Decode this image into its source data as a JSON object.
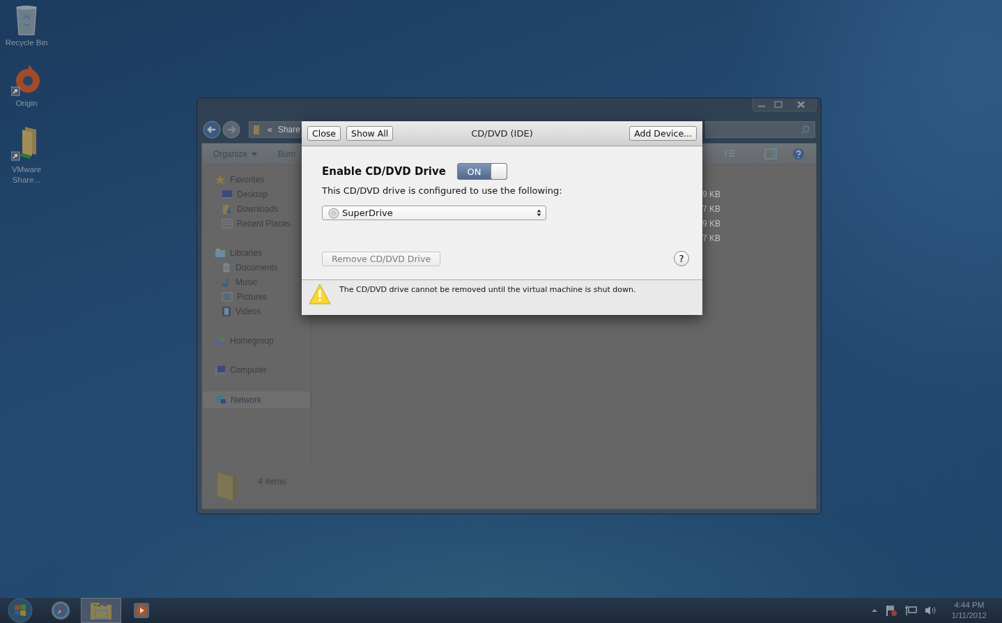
{
  "desktop_icons": [
    {
      "kind": "recycle-bin",
      "label": "Recycle Bin",
      "shortcut": false
    },
    {
      "kind": "origin",
      "label": "Origin",
      "shortcut": true
    },
    {
      "kind": "folder",
      "label": "VMware Share...",
      "shortcut": true
    }
  ],
  "explorer": {
    "address": {
      "overflow": "«",
      "location": "Share"
    },
    "toolbar": [
      "Organize",
      "Burn"
    ],
    "sidebar": [
      {
        "kind": "star",
        "label": "Favorites",
        "selected": false,
        "children": [
          {
            "kind": "desktop",
            "label": "Desktop",
            "selected": false
          },
          {
            "kind": "downloads",
            "label": "Downloads",
            "selected": false
          },
          {
            "kind": "recent",
            "label": "Recent Places",
            "selected": false
          }
        ]
      },
      {
        "kind": "library",
        "label": "Libraries",
        "selected": false,
        "children": [
          {
            "kind": "document",
            "label": "Documents",
            "selected": false
          },
          {
            "kind": "music",
            "label": "Music",
            "selected": false
          },
          {
            "kind": "pictures",
            "label": "Pictures",
            "selected": false
          },
          {
            "kind": "videos",
            "label": "Videos",
            "selected": false
          }
        ]
      },
      {
        "kind": "homegroup",
        "label": "Homegroup",
        "selected": false
      },
      {
        "kind": "computer",
        "label": "Computer",
        "selected": false
      },
      {
        "kind": "network",
        "label": "Network",
        "selected": true
      }
    ],
    "file_sizes": [
      "9 KB",
      "7 KB",
      "9 KB",
      "7 KB"
    ],
    "status": "4 items"
  },
  "dialog": {
    "left_buttons": [
      "Close",
      "Show All"
    ],
    "title": "CD/DVD (IDE)",
    "add_button": "Add Device...",
    "enable": {
      "label": "Enable CD/DVD Drive",
      "toggle_text": "ON",
      "on": true
    },
    "description": "This CD/DVD drive is configured to use the following:",
    "drive": {
      "value": "SuperDrive"
    },
    "remove_button": {
      "label": "Remove CD/DVD Drive",
      "disabled": true
    },
    "help": "?",
    "warning": "The CD/DVD drive cannot be removed until the virtual machine is shut down."
  },
  "taskbar": {
    "items": [
      {
        "kind": "start",
        "selected": false
      },
      {
        "kind": "compass",
        "selected": false
      },
      {
        "kind": "explorer",
        "selected": true
      },
      {
        "kind": "media",
        "selected": false
      }
    ],
    "time": "4:44 PM",
    "date": "1/11/2012"
  }
}
